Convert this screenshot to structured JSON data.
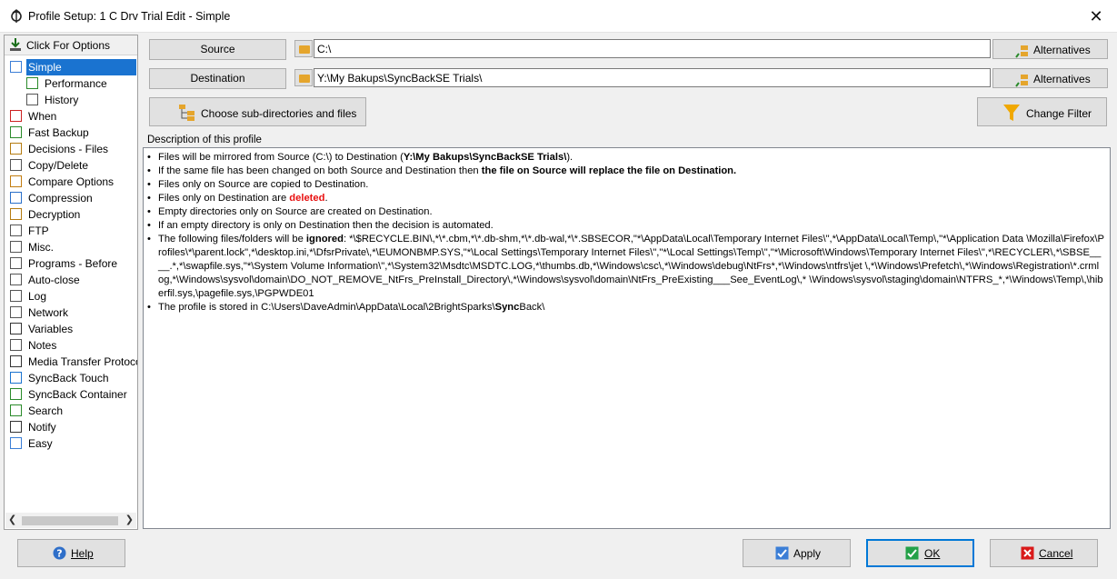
{
  "window": {
    "title": "Profile Setup: 1 C Drv Trial Edit - Simple",
    "close_glyph": "✕"
  },
  "sidebar": {
    "options_label": "Click For Options",
    "items": [
      {
        "label": "Simple",
        "icon": "simple-icon",
        "selected": true
      },
      {
        "label": "Performance",
        "icon": "performance-icon",
        "sub": true
      },
      {
        "label": "History",
        "icon": "history-icon",
        "sub": true
      },
      {
        "label": "When",
        "icon": "when-icon"
      },
      {
        "label": "Fast Backup",
        "icon": "fast-backup-icon"
      },
      {
        "label": "Decisions - Files",
        "icon": "decisions-icon"
      },
      {
        "label": "Copy/Delete",
        "icon": "copy-delete-icon"
      },
      {
        "label": "Compare Options",
        "icon": "compare-icon"
      },
      {
        "label": "Compression",
        "icon": "compression-icon"
      },
      {
        "label": "Decryption",
        "icon": "decryption-icon"
      },
      {
        "label": "FTP",
        "icon": "ftp-icon"
      },
      {
        "label": "Misc.",
        "icon": "misc-icon"
      },
      {
        "label": "Programs - Before",
        "icon": "programs-icon"
      },
      {
        "label": "Auto-close",
        "icon": "auto-close-icon"
      },
      {
        "label": "Log",
        "icon": "log-icon"
      },
      {
        "label": "Network",
        "icon": "network-icon"
      },
      {
        "label": "Variables",
        "icon": "variables-icon"
      },
      {
        "label": "Notes",
        "icon": "notes-icon"
      },
      {
        "label": "Media Transfer Protocol",
        "icon": "mtp-icon"
      },
      {
        "label": "SyncBack Touch",
        "icon": "touch-icon"
      },
      {
        "label": "SyncBack Container",
        "icon": "container-icon"
      },
      {
        "label": "Search",
        "icon": "search-icon"
      },
      {
        "label": "Notify",
        "icon": "notify-icon"
      },
      {
        "label": "Easy",
        "icon": "easy-icon"
      }
    ]
  },
  "source": {
    "label": "Source",
    "path": "C:\\",
    "alt_label": "Alternatives"
  },
  "destination": {
    "label": "Destination",
    "path": "Y:\\My Bakups\\SyncBackSE Trials\\",
    "alt_label": "Alternatives"
  },
  "subdirs_label": "Choose sub-directories and files",
  "filter_label": "Change Filter",
  "description": {
    "heading": "Description of this profile",
    "l1_a": "Files will be mirrored from Source (C:\\) to Destination (",
    "l1_b": "Y:\\My Bakups\\SyncBackSE Trials\\",
    "l1_c": ").",
    "l2_a": "If the same file has been changed on both Source and Destination then ",
    "l2_b": "the file on Source will replace the file on Destination.",
    "l3": "Files only on Source are copied to Destination.",
    "l4_a": "Files only on Destination are ",
    "l4_b": "deleted",
    "l4_c": ".",
    "l5": "Empty directories only on Source are created on Destination.",
    "l6": "If an empty directory is only on Destination then the decision is automated.",
    "l7_a": "The following files/folders will be ",
    "l7_b": "ignored",
    "l7_c": ": *\\$RECYCLE.BIN\\,*\\*.cbm,*\\*.db-shm,*\\*.db-wal,*\\*.SBSECOR,\"*\\AppData\\Local\\Temporary Internet Files\\\",*\\AppData\\Local\\Temp\\,\"*\\Application Data \\Mozilla\\Firefox\\Profiles\\*\\parent.lock\",*\\desktop.ini,*\\DfsrPrivate\\,*\\EUMONBMP.SYS,\"*\\Local Settings\\Temporary Internet Files\\\",\"*\\Local Settings\\Temp\\\",\"*\\Microsoft\\Windows\\Temporary Internet Files\\\",*\\RECYCLER\\,*\\SBSE____.*,*\\swapfile.sys,\"*\\System Volume Information\\\",*\\System32\\Msdtc\\MSDTC.LOG,*\\thumbs.db,*\\Windows\\csc\\,*\\Windows\\debug\\NtFrs*,*\\Windows\\ntfrs\\jet \\,*\\Windows\\Prefetch\\,*\\Windows\\Registration\\*.crmlog,*\\Windows\\sysvol\\domain\\DO_NOT_REMOVE_NtFrs_PreInstall_Directory\\,*\\Windows\\sysvol\\domain\\NtFrs_PreExisting___See_EventLog\\,* \\Windows\\sysvol\\staging\\domain\\NTFRS_*,*\\Windows\\Temp\\,\\hiberfil.sys,\\pagefile.sys,\\PGPWDE01",
    "l8_a": "The profile is stored in C:\\Users\\DaveAdmin\\AppData\\Local\\2BrightSparks\\",
    "l8_b": "Sync",
    "l8_c": "Back\\"
  },
  "buttons": {
    "help": "Help",
    "apply": "Apply",
    "ok": "OK",
    "cancel": "Cancel"
  },
  "colors": {
    "selection": "#1a73d0",
    "deleted": "#e81010",
    "ok_border": "#0078d7"
  }
}
